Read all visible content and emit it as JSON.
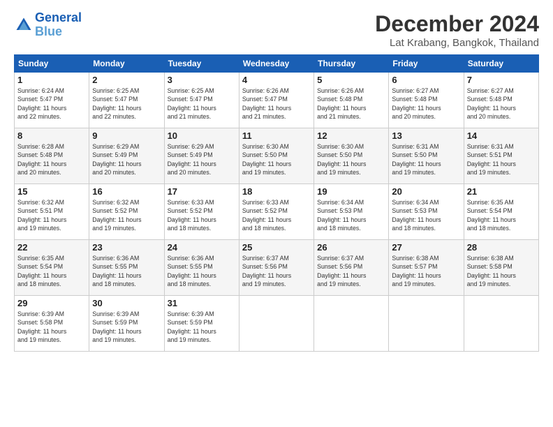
{
  "logo": {
    "line1": "General",
    "line2": "Blue"
  },
  "header": {
    "month": "December 2024",
    "location": "Lat Krabang, Bangkok, Thailand"
  },
  "weekdays": [
    "Sunday",
    "Monday",
    "Tuesday",
    "Wednesday",
    "Thursday",
    "Friday",
    "Saturday"
  ],
  "weeks": [
    [
      {
        "day": "1",
        "info": "Sunrise: 6:24 AM\nSunset: 5:47 PM\nDaylight: 11 hours\nand 22 minutes."
      },
      {
        "day": "2",
        "info": "Sunrise: 6:25 AM\nSunset: 5:47 PM\nDaylight: 11 hours\nand 22 minutes."
      },
      {
        "day": "3",
        "info": "Sunrise: 6:25 AM\nSunset: 5:47 PM\nDaylight: 11 hours\nand 21 minutes."
      },
      {
        "day": "4",
        "info": "Sunrise: 6:26 AM\nSunset: 5:47 PM\nDaylight: 11 hours\nand 21 minutes."
      },
      {
        "day": "5",
        "info": "Sunrise: 6:26 AM\nSunset: 5:48 PM\nDaylight: 11 hours\nand 21 minutes."
      },
      {
        "day": "6",
        "info": "Sunrise: 6:27 AM\nSunset: 5:48 PM\nDaylight: 11 hours\nand 20 minutes."
      },
      {
        "day": "7",
        "info": "Sunrise: 6:27 AM\nSunset: 5:48 PM\nDaylight: 11 hours\nand 20 minutes."
      }
    ],
    [
      {
        "day": "8",
        "info": "Sunrise: 6:28 AM\nSunset: 5:48 PM\nDaylight: 11 hours\nand 20 minutes."
      },
      {
        "day": "9",
        "info": "Sunrise: 6:29 AM\nSunset: 5:49 PM\nDaylight: 11 hours\nand 20 minutes."
      },
      {
        "day": "10",
        "info": "Sunrise: 6:29 AM\nSunset: 5:49 PM\nDaylight: 11 hours\nand 20 minutes."
      },
      {
        "day": "11",
        "info": "Sunrise: 6:30 AM\nSunset: 5:50 PM\nDaylight: 11 hours\nand 19 minutes."
      },
      {
        "day": "12",
        "info": "Sunrise: 6:30 AM\nSunset: 5:50 PM\nDaylight: 11 hours\nand 19 minutes."
      },
      {
        "day": "13",
        "info": "Sunrise: 6:31 AM\nSunset: 5:50 PM\nDaylight: 11 hours\nand 19 minutes."
      },
      {
        "day": "14",
        "info": "Sunrise: 6:31 AM\nSunset: 5:51 PM\nDaylight: 11 hours\nand 19 minutes."
      }
    ],
    [
      {
        "day": "15",
        "info": "Sunrise: 6:32 AM\nSunset: 5:51 PM\nDaylight: 11 hours\nand 19 minutes."
      },
      {
        "day": "16",
        "info": "Sunrise: 6:32 AM\nSunset: 5:52 PM\nDaylight: 11 hours\nand 19 minutes."
      },
      {
        "day": "17",
        "info": "Sunrise: 6:33 AM\nSunset: 5:52 PM\nDaylight: 11 hours\nand 18 minutes."
      },
      {
        "day": "18",
        "info": "Sunrise: 6:33 AM\nSunset: 5:52 PM\nDaylight: 11 hours\nand 18 minutes."
      },
      {
        "day": "19",
        "info": "Sunrise: 6:34 AM\nSunset: 5:53 PM\nDaylight: 11 hours\nand 18 minutes."
      },
      {
        "day": "20",
        "info": "Sunrise: 6:34 AM\nSunset: 5:53 PM\nDaylight: 11 hours\nand 18 minutes."
      },
      {
        "day": "21",
        "info": "Sunrise: 6:35 AM\nSunset: 5:54 PM\nDaylight: 11 hours\nand 18 minutes."
      }
    ],
    [
      {
        "day": "22",
        "info": "Sunrise: 6:35 AM\nSunset: 5:54 PM\nDaylight: 11 hours\nand 18 minutes."
      },
      {
        "day": "23",
        "info": "Sunrise: 6:36 AM\nSunset: 5:55 PM\nDaylight: 11 hours\nand 18 minutes."
      },
      {
        "day": "24",
        "info": "Sunrise: 6:36 AM\nSunset: 5:55 PM\nDaylight: 11 hours\nand 18 minutes."
      },
      {
        "day": "25",
        "info": "Sunrise: 6:37 AM\nSunset: 5:56 PM\nDaylight: 11 hours\nand 19 minutes."
      },
      {
        "day": "26",
        "info": "Sunrise: 6:37 AM\nSunset: 5:56 PM\nDaylight: 11 hours\nand 19 minutes."
      },
      {
        "day": "27",
        "info": "Sunrise: 6:38 AM\nSunset: 5:57 PM\nDaylight: 11 hours\nand 19 minutes."
      },
      {
        "day": "28",
        "info": "Sunrise: 6:38 AM\nSunset: 5:58 PM\nDaylight: 11 hours\nand 19 minutes."
      }
    ],
    [
      {
        "day": "29",
        "info": "Sunrise: 6:39 AM\nSunset: 5:58 PM\nDaylight: 11 hours\nand 19 minutes."
      },
      {
        "day": "30",
        "info": "Sunrise: 6:39 AM\nSunset: 5:59 PM\nDaylight: 11 hours\nand 19 minutes."
      },
      {
        "day": "31",
        "info": "Sunrise: 6:39 AM\nSunset: 5:59 PM\nDaylight: 11 hours\nand 19 minutes."
      },
      null,
      null,
      null,
      null
    ]
  ]
}
